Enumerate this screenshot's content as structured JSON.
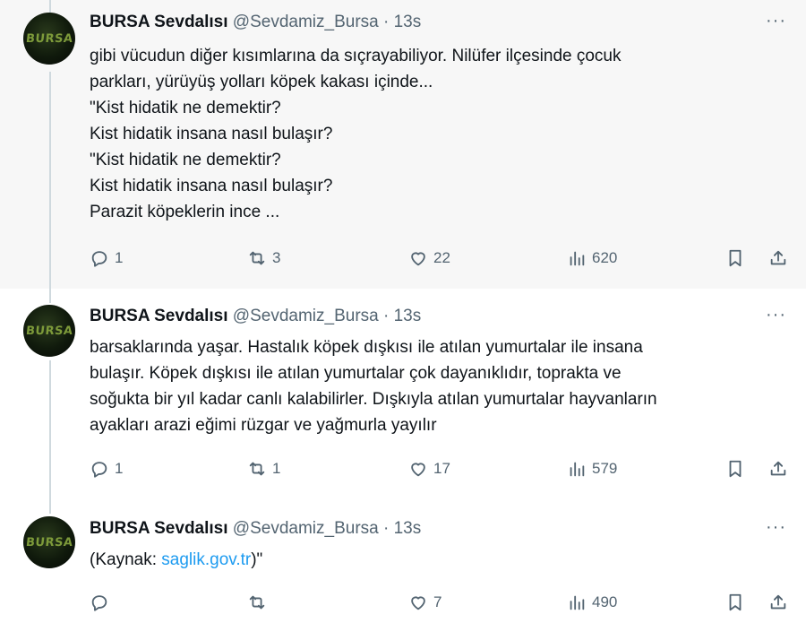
{
  "tweets": [
    {
      "author": {
        "name": "BURSA Sevdalısı",
        "handle": "@Sevdamiz_Bursa",
        "time": "13s",
        "avatar_text": "BURSA"
      },
      "lines": [
        "gibi vücudun diğer kısımlarına da sıçrayabiliyor. Nilüfer ilçesinde çocuk",
        "parkları, yürüyüş yolları köpek kakası içinde...",
        "\"Kist hidatik ne demektir?",
        "Kist hidatik insana nasıl bulaşır?",
        "\"Kist hidatik ne demektir?",
        "Kist hidatik insana nasıl bulaşır?",
        "Parazit köpeklerin ince ..."
      ],
      "stats": {
        "replies": "1",
        "reposts": "3",
        "likes": "22",
        "views": "620"
      }
    },
    {
      "author": {
        "name": "BURSA Sevdalısı",
        "handle": "@Sevdamiz_Bursa",
        "time": "13s",
        "avatar_text": "BURSA"
      },
      "lines": [
        "barsaklarında yaşar. Hastalık köpek dışkısı ile atılan yumurtalar ile insana",
        "bulaşır. Köpek dışkısı ile atılan yumurtalar çok dayanıklıdır, toprakta ve",
        "soğukta bir yıl kadar canlı kalabilirler. Dışkıyla atılan yumurtalar hayvanların",
        "ayakları arazi eğimi rüzgar ve yağmurla yayılır"
      ],
      "stats": {
        "replies": "1",
        "reposts": "1",
        "likes": "17",
        "views": "579"
      }
    },
    {
      "author": {
        "name": "BURSA Sevdalısı",
        "handle": "@Sevdamiz_Bursa",
        "time": "13s",
        "avatar_text": "BURSA"
      },
      "text_prefix": "(Kaynak: ",
      "link": "saglik.gov.tr",
      "text_suffix": ")\"",
      "stats": {
        "replies": "",
        "reposts": "",
        "likes": "7",
        "views": "490"
      }
    }
  ],
  "separator": "·",
  "more_glyph": "···",
  "colors": {
    "text": "#0f1419",
    "muted": "#536471",
    "link": "#1d9bf0",
    "highlight_bg": "#f7f7f7",
    "avatar_text": "#7d9a3a"
  },
  "icons": [
    "reply-icon",
    "repost-icon",
    "like-icon",
    "views-icon",
    "bookmark-icon",
    "share-icon"
  ]
}
